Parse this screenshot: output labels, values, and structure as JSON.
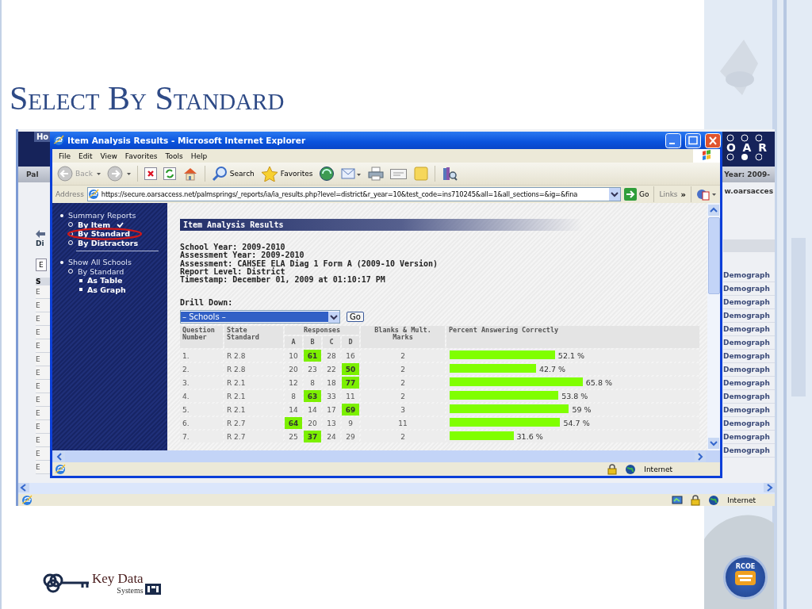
{
  "slide": {
    "title": "Select By Standard",
    "footer_logo": {
      "name": "Key Data",
      "subtitle": "Systems"
    },
    "badge": "RCOE"
  },
  "screenshot": {
    "background_app": {
      "header_tab": "Ho",
      "logo": "OAR",
      "left_bar_text": "Pal",
      "right_bar_text": "Year: 2009-",
      "url_fragment": "w.oarsacces",
      "left_heading": "Di",
      "left_field": "E",
      "left_column_header": "S",
      "left_rows": [
        "E",
        "E",
        "E",
        "E",
        "E",
        "E",
        "E",
        "E",
        "E",
        "E",
        "E",
        "E",
        "E",
        "E"
      ],
      "right_rows": [
        "Demograph",
        "Demograph",
        "Demograph",
        "Demograph",
        "Demograph",
        "Demograph",
        "Demograph",
        "Demograph",
        "Demograph",
        "Demograph",
        "Demograph",
        "Demograph",
        "Demograph",
        "Demograph"
      ],
      "status": "Internet"
    },
    "browser": {
      "title": "Item Analysis Results - Microsoft Internet Explorer",
      "menu": [
        "File",
        "Edit",
        "View",
        "Favorites",
        "Tools",
        "Help"
      ],
      "toolbar": [
        {
          "kind": "back",
          "label": "Back"
        },
        {
          "kind": "forward"
        },
        {
          "kind": "stop"
        },
        {
          "kind": "refresh"
        },
        {
          "kind": "home"
        },
        {
          "kind": "search",
          "label": "Search"
        },
        {
          "kind": "favorites",
          "label": "Favorites"
        },
        {
          "kind": "media"
        },
        {
          "kind": "mail"
        },
        {
          "kind": "print"
        },
        {
          "kind": "edit"
        },
        {
          "kind": "notes"
        },
        {
          "kind": "research"
        }
      ],
      "address_label": "Address",
      "url": "https://secure.oarsaccess.net/palmsprings/_reports/ia/ia_results.php?level=district&r_year=10&test_code=ins710245&all=1&all_sections=&ig=&fina",
      "go": "Go",
      "links": "Links",
      "links_more": "»",
      "status": "Internet"
    },
    "nav": [
      {
        "label": "Summary Reports",
        "children": [
          {
            "label": "By Item",
            "checked": true,
            "highlighted": false
          },
          {
            "label": "By Standard",
            "checked": false,
            "highlighted": true
          },
          {
            "label": "By Distractors",
            "checked": false,
            "highlighted": false
          }
        ]
      },
      {
        "label": "Show All Schools",
        "children": [
          {
            "label": "By Standard",
            "checked": false,
            "highlighted": false,
            "children": [
              {
                "label": "As Table"
              },
              {
                "label": "As Graph"
              }
            ]
          }
        ]
      }
    ],
    "page": {
      "heading": "Item Analysis Results",
      "info": [
        "School Year: 2009-2010",
        "Assessment Year: 2009-2010",
        "Assessment: CAHSEE ELA Diag 1 Form A (2009-10 Version)",
        "Report Level: District",
        "Timestamp: December 01, 2009 at 01:10:17 PM"
      ],
      "drill_label": "Drill Down:",
      "drill_value": "– Schools –",
      "drill_button": "Go",
      "table": {
        "columns": [
          "Question Number",
          "State Standard",
          "Responses",
          "Blanks & Mult. Marks",
          "Percent Answering Correctly"
        ],
        "choices": [
          "A",
          "B",
          "C",
          "D"
        ],
        "rows": [
          {
            "number": "1.",
            "standard": "R 2.8",
            "responses": [
              {
                "value": "10",
                "correct": false
              },
              {
                "value": "61",
                "correct": true
              },
              {
                "value": "28",
                "correct": false
              },
              {
                "value": "16",
                "correct": false
              }
            ],
            "blanks": "2",
            "percent": "52.1 %",
            "level": 0.521
          },
          {
            "number": "2.",
            "standard": "R 2.8",
            "responses": [
              {
                "value": "20",
                "correct": false
              },
              {
                "value": "23",
                "correct": false
              },
              {
                "value": "22",
                "correct": false
              },
              {
                "value": "50",
                "correct": true
              }
            ],
            "blanks": "2",
            "percent": "42.7 %",
            "level": 0.427
          },
          {
            "number": "3.",
            "standard": "R 2.1",
            "responses": [
              {
                "value": "12",
                "correct": false
              },
              {
                "value": "8",
                "correct": false
              },
              {
                "value": "18",
                "correct": false
              },
              {
                "value": "77",
                "correct": true
              }
            ],
            "blanks": "2",
            "percent": "65.8 %",
            "level": 0.658
          },
          {
            "number": "4.",
            "standard": "R 2.1",
            "responses": [
              {
                "value": "8",
                "correct": false
              },
              {
                "value": "63",
                "correct": true
              },
              {
                "value": "33",
                "correct": false
              },
              {
                "value": "11",
                "correct": false
              }
            ],
            "blanks": "2",
            "percent": "53.8 %",
            "level": 0.538
          },
          {
            "number": "5.",
            "standard": "R 2.1",
            "responses": [
              {
                "value": "14",
                "correct": false
              },
              {
                "value": "14",
                "correct": false
              },
              {
                "value": "17",
                "correct": false
              },
              {
                "value": "69",
                "correct": true
              }
            ],
            "blanks": "3",
            "percent": "59 %",
            "level": 0.59
          },
          {
            "number": "6.",
            "standard": "R 2.7",
            "responses": [
              {
                "value": "64",
                "correct": true
              },
              {
                "value": "20",
                "correct": false
              },
              {
                "value": "13",
                "correct": false
              },
              {
                "value": "9",
                "correct": false
              }
            ],
            "blanks": "11",
            "percent": "54.7 %",
            "level": 0.547
          },
          {
            "number": "7.",
            "standard": "R 2.7",
            "responses": [
              {
                "value": "25",
                "correct": false
              },
              {
                "value": "37",
                "correct": true
              },
              {
                "value": "24",
                "correct": false
              },
              {
                "value": "29",
                "correct": false
              }
            ],
            "blanks": "2",
            "percent": "31.6 %",
            "level": 0.316
          }
        ]
      }
    }
  }
}
